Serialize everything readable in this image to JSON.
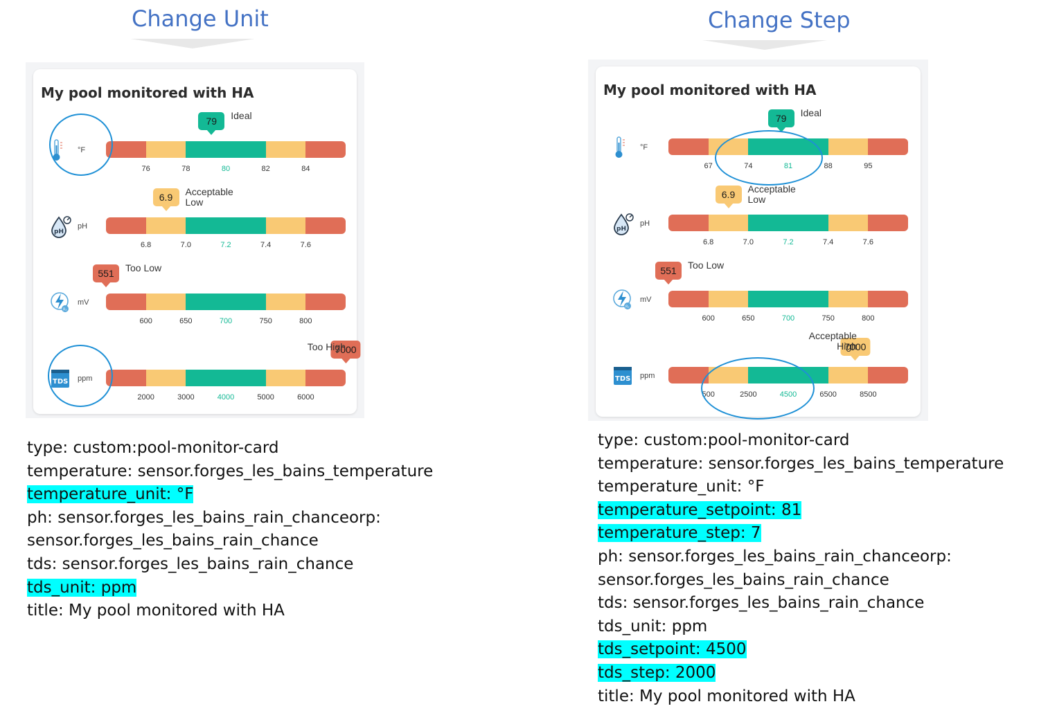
{
  "panels": [
    {
      "heading": "Change Unit",
      "card": {
        "title": "My pool monitored with HA",
        "rows": [
          {
            "icon": "thermometer-icon",
            "unit": "°F",
            "ticks": [
              "76",
              "78",
              "80",
              "82",
              "84"
            ],
            "value": "79",
            "value_pos": 0.44,
            "state": [
              "Ideal"
            ],
            "badge_color": "#13b995"
          },
          {
            "icon": "ph-drop-icon",
            "unit": "pH",
            "ticks": [
              "6.8",
              "7.0",
              "7.2",
              "7.4",
              "7.6"
            ],
            "value": "6.9",
            "value_pos": 0.25,
            "state": [
              "Acceptable",
              "Low"
            ],
            "badge_color": "#f9c974"
          },
          {
            "icon": "orp-bolt-icon",
            "unit": "mV",
            "ticks": [
              "600",
              "650",
              "700",
              "750",
              "800"
            ],
            "value": "551",
            "value_pos": 0.0,
            "state": [
              "Too Low"
            ],
            "badge_color": "#e06e57"
          },
          {
            "icon": "tds-icon",
            "unit": "ppm",
            "ticks": [
              "2000",
              "3000",
              "4000",
              "5000",
              "6000"
            ],
            "value": "7000",
            "value_pos": 1.0,
            "state": [
              "Too High"
            ],
            "badge_color": "#e06e57",
            "state_left": true
          }
        ]
      },
      "yaml": [
        {
          "text": "type: custom:pool-monitor-card",
          "hl": false
        },
        {
          "text": "temperature: sensor.forges_les_bains_temperature",
          "hl": false
        },
        {
          "text": "temperature_unit: °F",
          "hl": true
        },
        {
          "text": "ph: sensor.forges_les_bains_rain_chanceorp:",
          "hl": false
        },
        {
          "text": "sensor.forges_les_bains_rain_chance",
          "hl": false
        },
        {
          "text": "tds: sensor.forges_les_bains_rain_chance",
          "hl": false
        },
        {
          "text": "tds_unit: ppm",
          "hl": true
        },
        {
          "text": "title: My pool monitored with HA",
          "hl": false
        }
      ]
    },
    {
      "heading": "Change Step",
      "card": {
        "title": "My pool monitored with HA",
        "rows": [
          {
            "icon": "thermometer-icon",
            "unit": "°F",
            "ticks": [
              "67",
              "74",
              "81",
              "88",
              "95"
            ],
            "value": "79",
            "value_pos": 0.47,
            "state": [
              "Ideal"
            ],
            "badge_color": "#13b995"
          },
          {
            "icon": "ph-drop-icon",
            "unit": "pH",
            "ticks": [
              "6.8",
              "7.0",
              "7.2",
              "7.4",
              "7.6"
            ],
            "value": "6.9",
            "value_pos": 0.25,
            "state": [
              "Acceptable",
              "Low"
            ],
            "badge_color": "#f9c974"
          },
          {
            "icon": "orp-bolt-icon",
            "unit": "mV",
            "ticks": [
              "600",
              "650",
              "700",
              "750",
              "800"
            ],
            "value": "551",
            "value_pos": 0.0,
            "state": [
              "Too Low"
            ],
            "badge_color": "#e06e57"
          },
          {
            "icon": "tds-icon",
            "unit": "ppm",
            "ticks": [
              "500",
              "2500",
              "4500",
              "6500",
              "8500"
            ],
            "value": "7000",
            "value_pos": 0.78,
            "state": [
              "Acceptable",
              "High"
            ],
            "badge_color": "#f9c974",
            "state_left": true
          }
        ]
      },
      "yaml": [
        {
          "text": "type: custom:pool-monitor-card",
          "hl": false
        },
        {
          "text": "temperature: sensor.forges_les_bains_temperature",
          "hl": false
        },
        {
          "text": "temperature_unit: °F",
          "hl": false
        },
        {
          "text": "temperature_setpoint: 81",
          "hl": true
        },
        {
          "text": "temperature_step: 7",
          "hl": true
        },
        {
          "text": "ph: sensor.forges_les_bains_rain_chanceorp:",
          "hl": false
        },
        {
          "text": "sensor.forges_les_bains_rain_chance",
          "hl": false
        },
        {
          "text": "tds: sensor.forges_les_bains_rain_chance",
          "hl": false
        },
        {
          "text": "tds_unit: ppm",
          "hl": false
        },
        {
          "text": "tds_setpoint: 4500",
          "hl": true
        },
        {
          "text": "tds_step: 2000",
          "hl": true
        },
        {
          "text": "title: My pool monitored with HA",
          "hl": false
        }
      ]
    }
  ]
}
